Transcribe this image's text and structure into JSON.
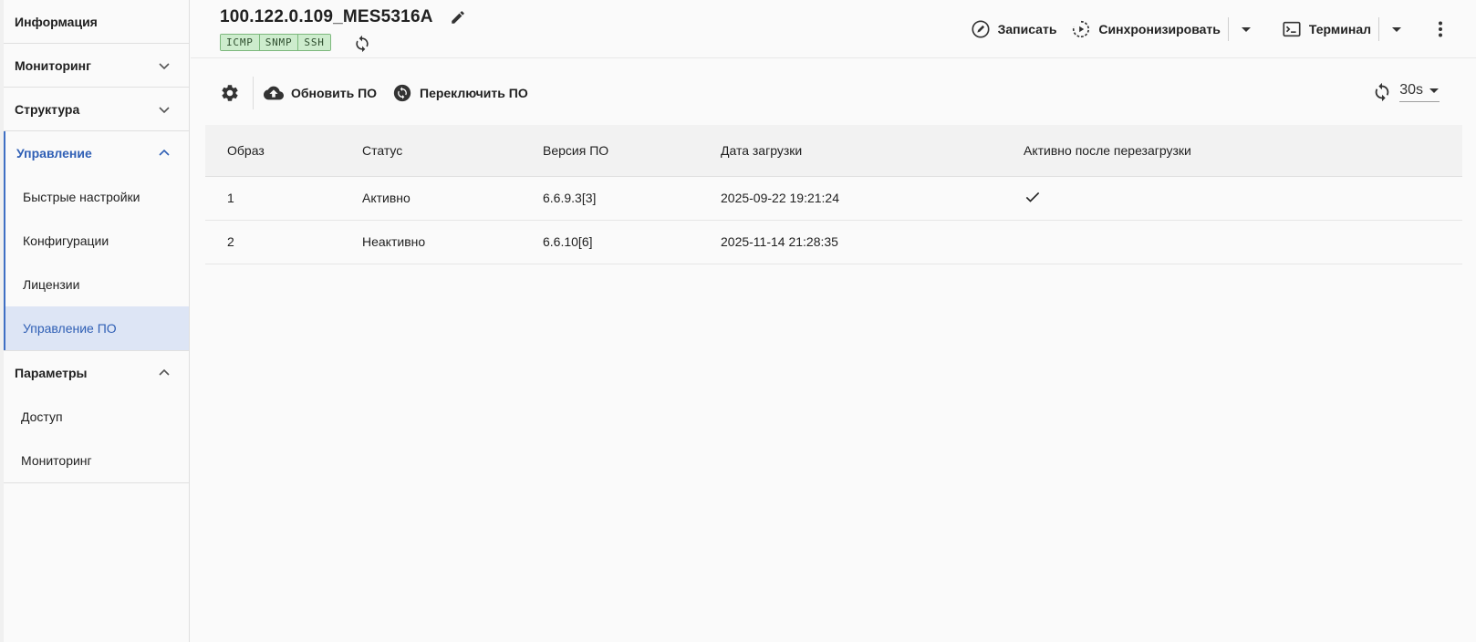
{
  "sidebar": {
    "info": "Информация",
    "monitoring": "Мониторинг",
    "structure": "Структура",
    "management": {
      "label": "Управление",
      "items": [
        {
          "label": "Быстрые настройки"
        },
        {
          "label": "Конфигурации"
        },
        {
          "label": "Лицензии"
        },
        {
          "label": "Управление ПО",
          "selected": true
        }
      ]
    },
    "parameters": {
      "label": "Параметры",
      "items": [
        {
          "label": "Доступ"
        },
        {
          "label": "Мониторинг"
        }
      ]
    }
  },
  "header": {
    "device_title": "100.122.0.109_MES5316A",
    "protocols": [
      "ICMP",
      "SNMP",
      "SSH"
    ],
    "write_label": "Записать",
    "sync_label": "Синхронизировать",
    "terminal_label": "Терминал"
  },
  "toolbar": {
    "update_fw_label": "Обновить ПО",
    "switch_fw_label": "Переключить ПО",
    "refresh_interval": "30s"
  },
  "table": {
    "columns": [
      "Образ",
      "Статус",
      "Версия ПО",
      "Дата загрузки",
      "Активно после перезагрузки"
    ],
    "rows": [
      {
        "image": "1",
        "status": "Активно",
        "version": "6.6.9.3[3]",
        "date": "2025-09-22 19:21:24",
        "active_after_reboot": true
      },
      {
        "image": "2",
        "status": "Неактивно",
        "version": "6.6.10[6]",
        "date": "2025-11-14 21:28:35",
        "active_after_reboot": false
      }
    ]
  },
  "colors": {
    "accent": "#2f5fb5",
    "selected_bg": "#dde5f5",
    "status_active": "#2e8b2e",
    "protocol_bg": "#cdeccd"
  }
}
